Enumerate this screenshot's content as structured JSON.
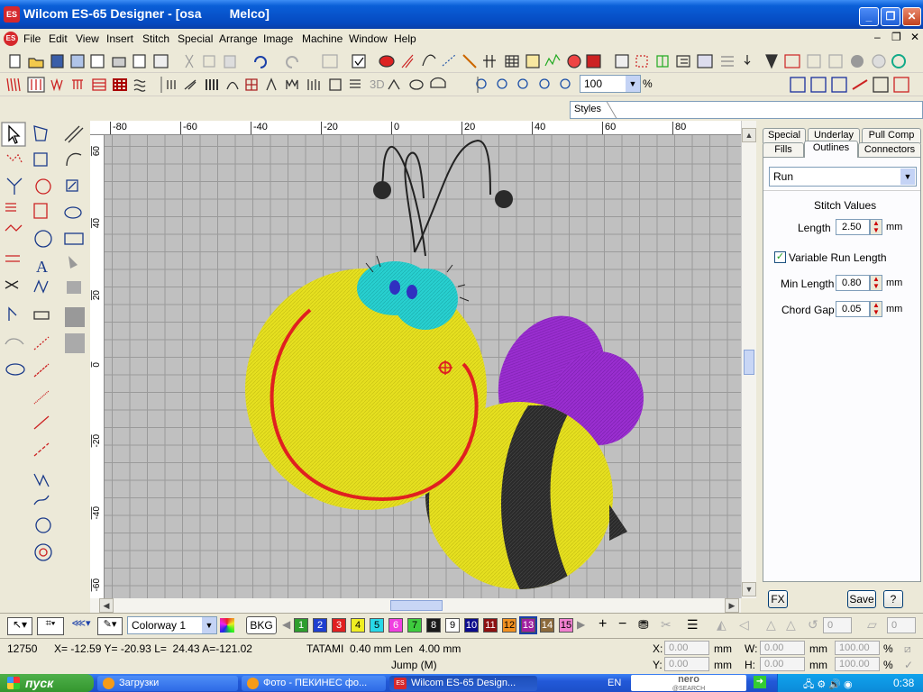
{
  "window": {
    "title": "Wilcom ES-65 Designer - [osa        Melco]",
    "app_icon": "ES"
  },
  "menu": [
    "File",
    "Edit",
    "View",
    "Insert",
    "Stitch",
    "Special",
    "Arrange",
    "Image",
    "Machine",
    "Window",
    "Help"
  ],
  "toolbar": {
    "zoom_value": "100",
    "zoom_unit": "%",
    "three_d_label": "3D"
  },
  "styles_label": "Styles",
  "rulers": {
    "h": [
      "-80",
      "-60",
      "-40",
      "-20",
      "0",
      "20",
      "40",
      "60",
      "80"
    ],
    "v": [
      "60",
      "40",
      "20",
      "0",
      "-20",
      "-40",
      "-60"
    ]
  },
  "tabs": {
    "row1": [
      "Special",
      "Underlay",
      "Pull Comp"
    ],
    "row2": [
      "Fills",
      "Outlines",
      "Connectors"
    ],
    "active": "Outlines"
  },
  "panel": {
    "stitch_type": "Run",
    "section_title": "Stitch Values",
    "length_label": "Length",
    "length_value": "2.50",
    "variable_label": "Variable Run Length",
    "variable_checked": true,
    "min_length_label": "Min Length",
    "min_length_value": "0.80",
    "chord_gap_label": "Chord Gap",
    "chord_gap_value": "0.05",
    "unit": "mm",
    "fx_label": "FX",
    "save_label": "Save",
    "help_label": "?"
  },
  "bottom": {
    "colorway": "Colorway 1",
    "bkg_label": "BKG",
    "colors": [
      {
        "n": "1",
        "bg": "#2e9e2e",
        "fg": "#ffffff"
      },
      {
        "n": "2",
        "bg": "#1e3fcf",
        "fg": "#ffffff"
      },
      {
        "n": "3",
        "bg": "#e02020",
        "fg": "#ffffff"
      },
      {
        "n": "4",
        "bg": "#f0ee22",
        "fg": "#000000"
      },
      {
        "n": "5",
        "bg": "#28d8e8",
        "fg": "#000000"
      },
      {
        "n": "6",
        "bg": "#f040e0",
        "fg": "#ffffff"
      },
      {
        "n": "7",
        "bg": "#3ecb3e",
        "fg": "#000000"
      },
      {
        "n": "8",
        "bg": "#1a1a1a",
        "fg": "#ffffff"
      },
      {
        "n": "9",
        "bg": "#ffffff",
        "fg": "#000000"
      },
      {
        "n": "10",
        "bg": "#0c0c8c",
        "fg": "#ffffff"
      },
      {
        "n": "11",
        "bg": "#8c1010",
        "fg": "#ffffff"
      },
      {
        "n": "12",
        "bg": "#f09020",
        "fg": "#000000"
      },
      {
        "n": "13",
        "bg": "#a020a0",
        "fg": "#ffffff"
      },
      {
        "n": "14",
        "bg": "#8c6a3c",
        "fg": "#ffffff"
      },
      {
        "n": "15",
        "bg": "#f080d0",
        "fg": "#000000"
      }
    ],
    "angle_value": "0",
    "angle_value2": "0"
  },
  "status": {
    "count": "12750",
    "coords": "X= -12.59 Y= -20.93 L=  24.43 A=-121.02",
    "stitch": "TATAMI  0.40 mm Len  4.00 mm",
    "jump": "Jump (M)",
    "x_label": "X:",
    "x_val": "0.00",
    "y_label": "Y:",
    "y_val": "0.00",
    "w_label": "W:",
    "w_val": "0.00",
    "h_label": "H:",
    "h_val": "0.00",
    "pct_val": "100.00",
    "pct_val2": "100.00",
    "mm": "mm",
    "pct": "%"
  },
  "taskbar": {
    "start": "пуск",
    "tasks": [
      "Загрузки",
      "Фото - ПЕКИНЕС фо...",
      "Wilcom ES-65 Design..."
    ],
    "lang": "EN",
    "search_logo": "nero",
    "search_logo_sub": "@SEARCH",
    "clock": "0:38"
  },
  "colors": {
    "title_blue": "#0a5fd8",
    "canvas_bg": "#c0c0c0",
    "bee_yellow": "#e6e020",
    "bee_black": "#2a2a2a",
    "wing_purple": "#9a2ed0",
    "eye_cyan": "#28d0d0",
    "smile_red": "#e02020"
  }
}
